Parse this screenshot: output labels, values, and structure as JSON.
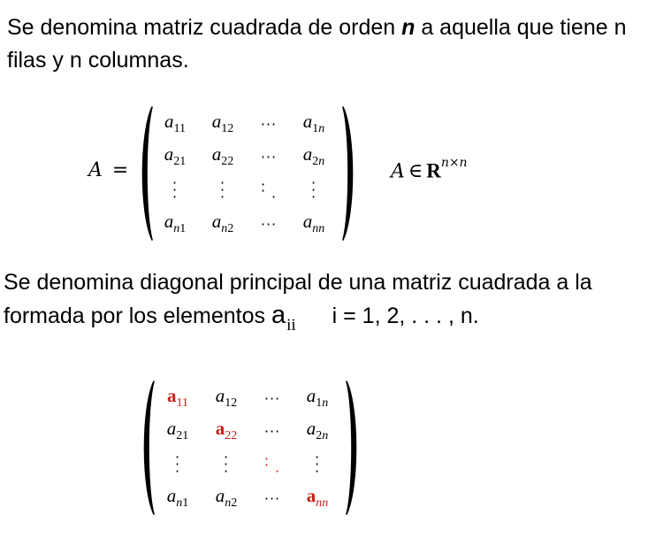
{
  "intro": {
    "text_before": "Se denomina matriz cuadrada de orden ",
    "order_symbol": "n",
    "text_after": " a aquella que tiene n filas y n columnas."
  },
  "equation": {
    "lhs": "A",
    "equals": "=",
    "membership": {
      "var": "A",
      "in_symbol": "∈",
      "set": "R",
      "exponent": "n×n"
    }
  },
  "matrix_general": {
    "rows": [
      [
        {
          "base": "a",
          "sub": "11"
        },
        {
          "base": "a",
          "sub": "12"
        },
        {
          "kind": "hdots"
        },
        {
          "base": "a",
          "sub": "1n"
        }
      ],
      [
        {
          "base": "a",
          "sub": "21"
        },
        {
          "base": "a",
          "sub": "22"
        },
        {
          "kind": "hdots"
        },
        {
          "base": "a",
          "sub": "2n"
        }
      ],
      [
        {
          "kind": "vdots"
        },
        {
          "kind": "vdots"
        },
        {
          "kind": "ddots"
        },
        {
          "kind": "vdots"
        }
      ],
      [
        {
          "base": "a",
          "sub": "n1"
        },
        {
          "base": "a",
          "sub": "n2"
        },
        {
          "kind": "hdots"
        },
        {
          "base": "a",
          "sub": "nn"
        }
      ]
    ]
  },
  "diagonal": {
    "text_before": "Se denomina diagonal principal de una matriz cuadrada a la formada por los elementos ",
    "element_symbol": "a",
    "element_sub": "ii",
    "index_range": "i = 1, 2, . . . , n."
  },
  "matrix_diagonal": {
    "highlight_color": "#c8201a",
    "rows": [
      [
        {
          "base": "a",
          "sub": "11",
          "highlight": true
        },
        {
          "base": "a",
          "sub": "12"
        },
        {
          "kind": "hdots"
        },
        {
          "base": "a",
          "sub": "1n"
        }
      ],
      [
        {
          "base": "a",
          "sub": "21"
        },
        {
          "base": "a",
          "sub": "22",
          "highlight": true
        },
        {
          "kind": "hdots"
        },
        {
          "base": "a",
          "sub": "2n"
        }
      ],
      [
        {
          "kind": "vdots"
        },
        {
          "kind": "vdots"
        },
        {
          "kind": "ddots",
          "highlight": true
        },
        {
          "kind": "vdots"
        }
      ],
      [
        {
          "base": "a",
          "sub": "n1"
        },
        {
          "base": "a",
          "sub": "n2"
        },
        {
          "kind": "hdots"
        },
        {
          "base": "a",
          "sub": "nn",
          "highlight": true
        }
      ]
    ]
  }
}
